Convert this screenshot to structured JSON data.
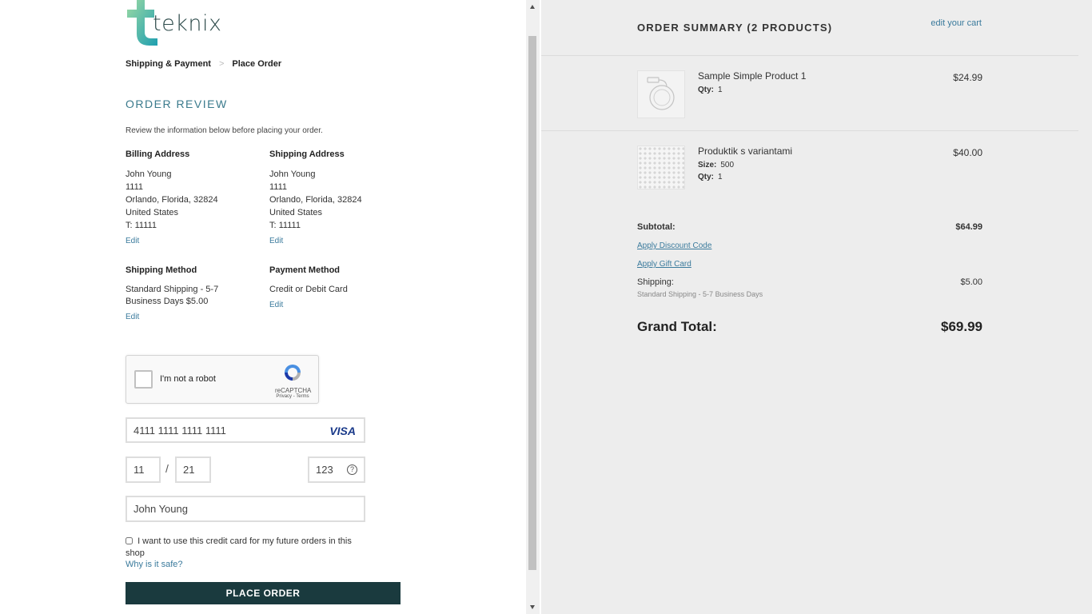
{
  "brand": {
    "name": "teknix"
  },
  "breadcrumb": {
    "step1": "Shipping & Payment",
    "separator": ">",
    "step2": "Place Order"
  },
  "review": {
    "title": "ORDER REVIEW",
    "description": "Review the information below before placing your order."
  },
  "billing": {
    "heading": "Billing Address",
    "name": "John Young",
    "street": "1111",
    "city_line": "Orlando, Florida, 32824",
    "country": "United States",
    "phone": "T: 11111",
    "edit": "Edit"
  },
  "shipping_address": {
    "heading": "Shipping Address",
    "name": "John Young",
    "street": "1111",
    "city_line": "Orlando, Florida, 32824",
    "country": "United States",
    "phone": "T: 11111",
    "edit": "Edit"
  },
  "shipping_method": {
    "heading": "Shipping Method",
    "value": "Standard Shipping - 5-7 Business Days $5.00",
    "edit": "Edit"
  },
  "payment_method": {
    "heading": "Payment Method",
    "value": "Credit or Debit Card",
    "edit": "Edit"
  },
  "captcha": {
    "label": "I'm not a robot",
    "brand": "reCAPTCHA",
    "terms": "Privacy - Terms"
  },
  "card": {
    "number": "4111 1111 1111 1111",
    "brand": "VISA",
    "month": "11",
    "separator": "/",
    "year": "21",
    "cvv": "123",
    "cvv_help": "?",
    "holder": "John Young",
    "save_label": "I want to use this credit card for my future orders in this shop",
    "why_safe": "Why is it safe?"
  },
  "place_order": "PLACE ORDER",
  "summary": {
    "title": "ORDER SUMMARY (2 PRODUCTS)",
    "edit_cart": "edit your cart",
    "items": [
      {
        "name": "Sample Simple Product 1",
        "qty_label": "Qty:",
        "qty": "1",
        "price": "$24.99"
      },
      {
        "name": "Produktik s variantami",
        "size_label": "Size:",
        "size": "500",
        "qty_label": "Qty:",
        "qty": "1",
        "price": "$40.00"
      }
    ],
    "subtotal_label": "Subtotal:",
    "subtotal": "$64.99",
    "discount_link": "Apply Discount Code",
    "gift_link": "Apply Gift Card",
    "shipping_label": "Shipping:",
    "shipping_desc": "Standard Shipping - 5-7 Business Days",
    "shipping": "$5.00",
    "grand_label": "Grand Total:",
    "grand": "$69.99"
  },
  "colors": {
    "accent": "#3a7a9c",
    "button": "#1a3a3e",
    "panel": "#ededed",
    "logo_green": "#3cbf8f"
  }
}
